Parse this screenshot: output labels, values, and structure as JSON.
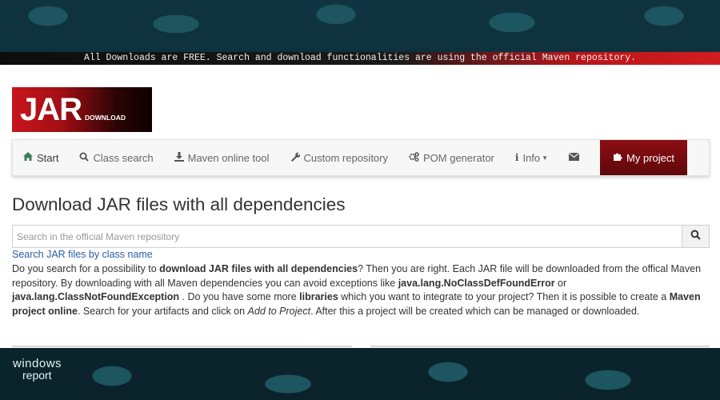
{
  "banner": {
    "text": "All Downloads are FREE. Search and download functionalities are using the official Maven repository."
  },
  "logo": {
    "big": "JAR",
    "small": "DOWNLOAD"
  },
  "nav": {
    "items": [
      {
        "label": "Start",
        "icon": "home-icon"
      },
      {
        "label": "Class search",
        "icon": "search-icon"
      },
      {
        "label": "Maven online tool",
        "icon": "download-icon"
      },
      {
        "label": "Custom repository",
        "icon": "wrench-icon"
      },
      {
        "label": "POM generator",
        "icon": "gears-icon"
      },
      {
        "label": "Info",
        "icon": "info-icon"
      },
      {
        "label": "",
        "icon": "envelope-icon"
      },
      {
        "label": "My project",
        "icon": "puzzle-icon"
      }
    ]
  },
  "main": {
    "heading": "Download JAR files with all dependencies",
    "search_placeholder": "Search in the official Maven repository",
    "class_link": "Search JAR files by class name",
    "desc": {
      "p1": "Do you search for a possibility to ",
      "b1": "download JAR files with all dependencies",
      "p2": "? Then you are right. Each JAR file will be downloaded from the offical Maven repository. By downloading with all Maven dependencies you can avoid exceptions like ",
      "b2": "java.lang.NoClassDefFoundError",
      "p3": " or ",
      "b3": "java.lang.ClassNotFoundException",
      "p4": " . Do you have some more ",
      "b4": "libraries",
      "p5": " which you want to integrate to your project? Then it is possible to create a ",
      "b5": "Maven project online",
      "p6": ". Search for your artifacts and click on ",
      "i1": "Add to Project",
      "p7": ". After this a project will be created which can be managed or downloaded."
    }
  },
  "watermark": {
    "line1": "windows",
    "line2": "report"
  },
  "colors": {
    "banner_red": "#d21c1f",
    "project_button": "#7a0b10",
    "link_blue": "#2a5ca8"
  }
}
